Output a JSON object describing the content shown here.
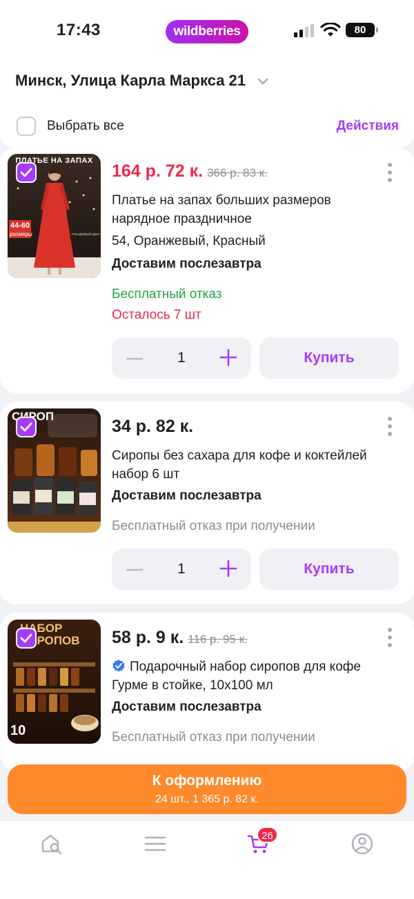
{
  "status_bar": {
    "time": "17:43",
    "brand": "wildberries",
    "battery": "80"
  },
  "header": {
    "address": "Минск, Улица Карла Маркса 21"
  },
  "select_bar": {
    "select_all": "Выбрать все",
    "actions": "Действия"
  },
  "items": [
    {
      "thumb_text": "ПЛАТЬЕ НА ЗАПАХ",
      "thumb_sizes": "44-60",
      "thumb_sizes_word": "размеры",
      "checked": true,
      "price": "164 р. 72 к.",
      "old_price": "366 р. 83 к.",
      "title": "Платье на запах больших размеров нарядное праздничное",
      "attrs": "54, Оранжевый, Красный",
      "delivery": "Доставим послезавтра",
      "return_note": "Бесплатный отказ",
      "stock_note": "Осталось 7 шт",
      "quantity": "1",
      "buy_label": "Купить"
    },
    {
      "thumb_text": "СИРОП",
      "checked": true,
      "price": "34 р. 82 к.",
      "title": "Сиропы без сахара для кофе и коктейлей набор 6 шт",
      "delivery": "Доставим послезавтра",
      "return_note": "Бесплатный отказ при получении",
      "quantity": "1",
      "buy_label": "Купить"
    },
    {
      "thumb_text": "НАБОР СИРОПОВ",
      "thumb_count": "10",
      "checked": true,
      "price": "58 р. 9 к.",
      "old_price": "116 р. 95 к.",
      "title": "Подарочный набор сиропов для кофе Гурме в стойке, 10х100 мл",
      "delivery": "Доставим послезавтра",
      "return_note": "Бесплатный отказ при получении"
    }
  ],
  "checkout": {
    "label": "К оформлению",
    "summary": "24 шт., 1 365 р. 82 к."
  },
  "tabbar": {
    "cart_badge": "26"
  },
  "colors": {
    "accent": "#a73afd",
    "sale": "#f0284a",
    "checkout": "#ff8a2b",
    "green": "#22a24a"
  }
}
